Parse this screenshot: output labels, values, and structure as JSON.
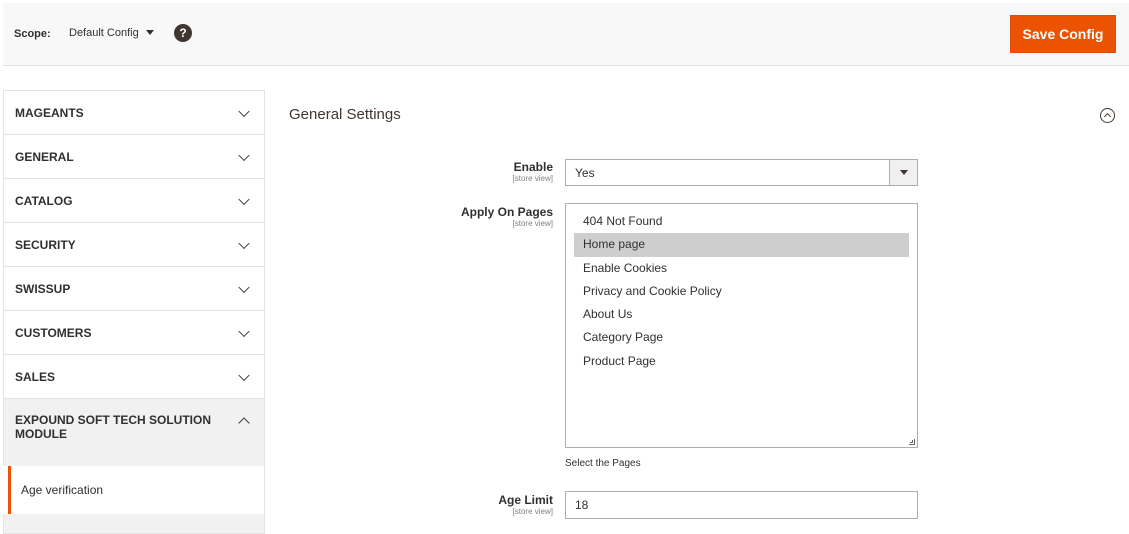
{
  "header": {
    "scope_label": "Scope:",
    "scope_value": "Default Config",
    "help_symbol": "?",
    "save_label": "Save Config",
    "accent_color": "#eb5202"
  },
  "sidebar": {
    "items": [
      {
        "label": "MAGEANTS",
        "expanded": false
      },
      {
        "label": "GENERAL",
        "expanded": false
      },
      {
        "label": "CATALOG",
        "expanded": false
      },
      {
        "label": "SECURITY",
        "expanded": false
      },
      {
        "label": "SWISSUP",
        "expanded": false
      },
      {
        "label": "CUSTOMERS",
        "expanded": false
      },
      {
        "label": "SALES",
        "expanded": false
      },
      {
        "label": "EXPOUND SOFT TECH SOLUTION MODULE",
        "expanded": true
      }
    ],
    "active_subitem": "Age verification"
  },
  "main": {
    "section_title": "General Settings",
    "fields": {
      "enable": {
        "label": "Enable",
        "scope": "[store view]",
        "value": "Yes"
      },
      "apply_on_pages": {
        "label": "Apply On Pages",
        "scope": "[store view]",
        "options": [
          "404 Not Found",
          "Home page",
          "Enable Cookies",
          "Privacy and Cookie Policy",
          "About Us",
          "Category Page",
          "Product Page"
        ],
        "selected": "Home page",
        "note": "Select the Pages"
      },
      "age_limit": {
        "label": "Age Limit",
        "scope": "[store view]",
        "value": "18"
      }
    }
  }
}
